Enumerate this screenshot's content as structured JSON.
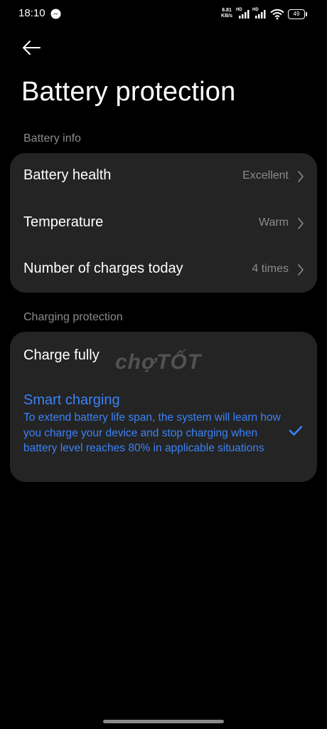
{
  "status_bar": {
    "time": "18:10",
    "net_speed_value": "6.81",
    "net_speed_unit": "KB/s",
    "signal_1_label": "HD",
    "signal_2_label": "HD",
    "battery_level": "49"
  },
  "header": {
    "title": "Battery protection"
  },
  "battery_info": {
    "section_label": "Battery info",
    "items": [
      {
        "label": "Battery health",
        "value": "Excellent"
      },
      {
        "label": "Temperature",
        "value": "Warm"
      },
      {
        "label": "Number of charges today",
        "value": "4 times"
      }
    ]
  },
  "charging_protection": {
    "section_label": "Charging protection",
    "options": [
      {
        "title": "Charge fully",
        "selected": false
      },
      {
        "title": "Smart charging",
        "description": "To extend battery life span, the system will learn how you charge your device and stop charging when battery level reaches 80% in applicable situations",
        "selected": true
      }
    ]
  },
  "watermark": "chợTỐT",
  "colors": {
    "background": "#000000",
    "card": "#242424",
    "accent": "#3b82f6",
    "secondary_text": "#8b8b8b"
  }
}
